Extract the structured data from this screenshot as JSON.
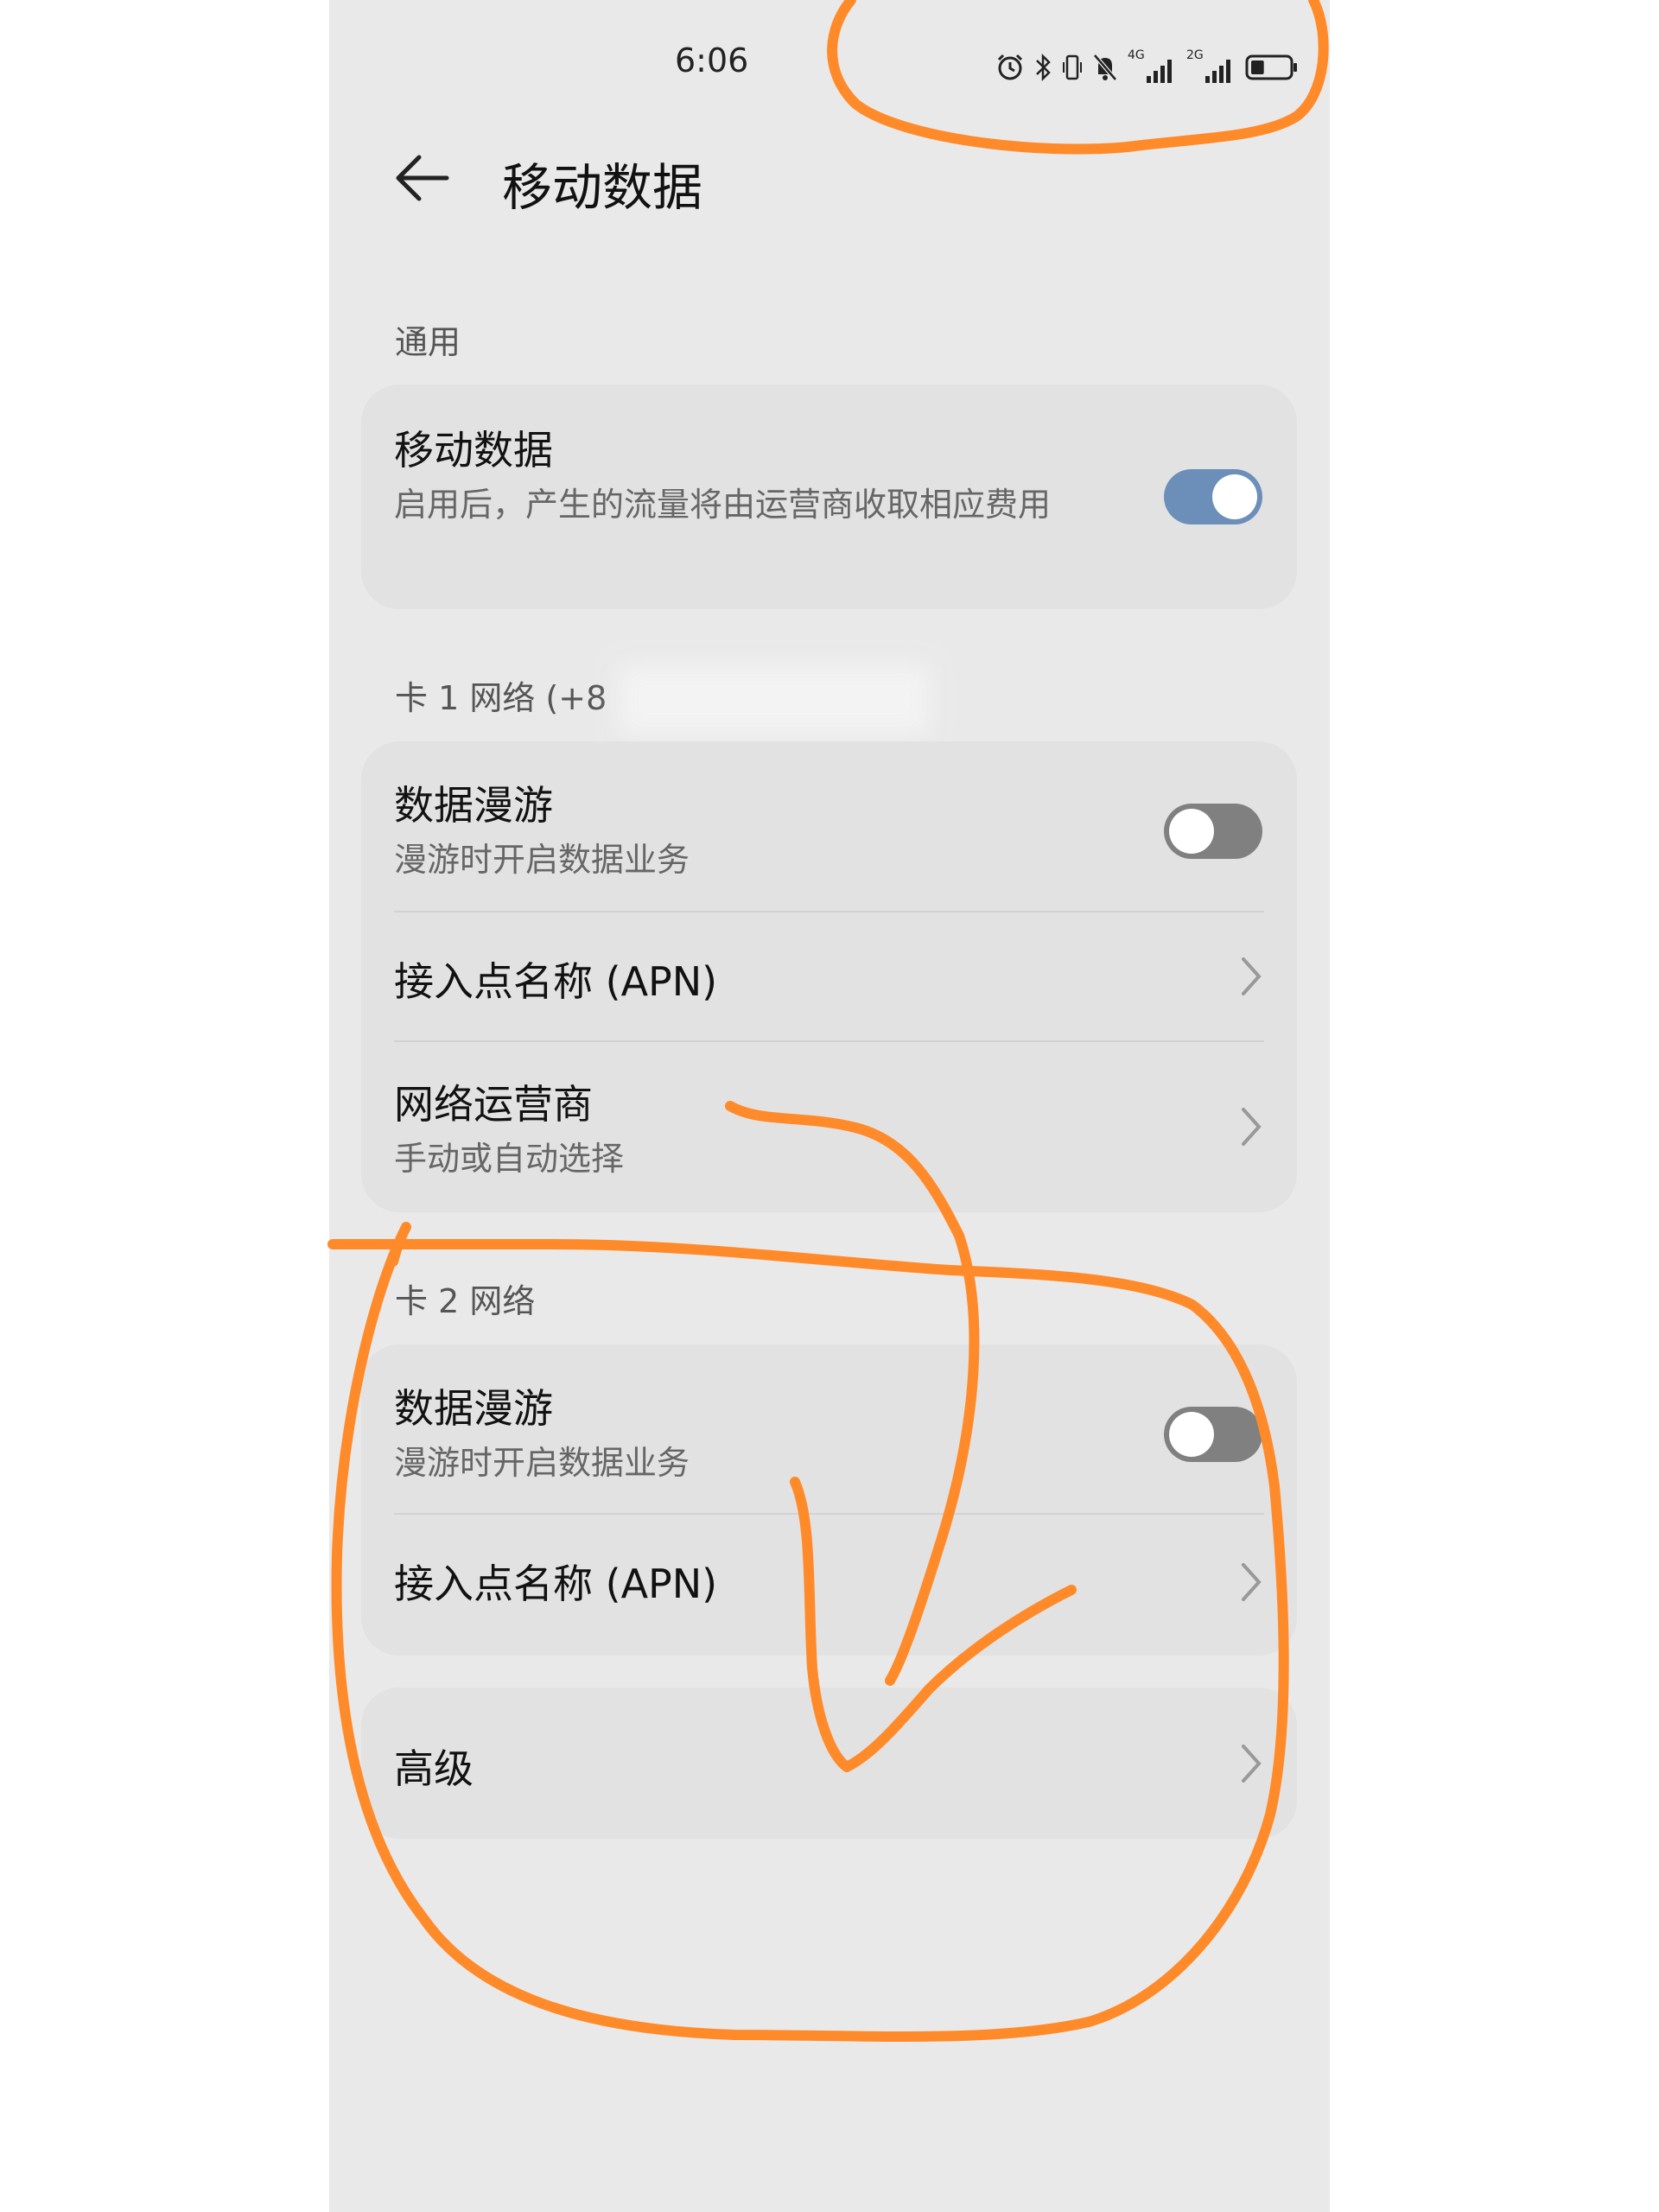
{
  "status_bar": {
    "time": "6:06",
    "sim1_network": "4G",
    "sim2_network": "2G",
    "battery_level": 0.35
  },
  "header": {
    "title": "移动数据"
  },
  "general": {
    "section_label": "通用",
    "mobile_data": {
      "title": "移动数据",
      "subtitle": "启用后，产生的流量将由运营商收取相应费用",
      "enabled": true
    }
  },
  "sim1": {
    "section_label": "卡 1 网络 (+8",
    "roaming": {
      "title": "数据漫游",
      "subtitle": "漫游时开启数据业务",
      "enabled": false
    },
    "apn_label": "接入点名称 (APN)",
    "carrier": {
      "title": "网络运营商",
      "subtitle": "手动或自动选择"
    }
  },
  "sim2": {
    "section_label": "卡 2 网络",
    "roaming": {
      "title": "数据漫游",
      "subtitle": "漫游时开启数据业务",
      "enabled": false
    },
    "apn_label": "接入点名称 (APN)"
  },
  "advanced": {
    "label": "高级"
  },
  "colors": {
    "toggle_on": "#6b8fb8",
    "toggle_off": "#808080",
    "annotation": "#ff8a2a",
    "background": "#e9e9e9",
    "card": "#e2e2e2"
  },
  "icons": [
    "alarm-icon",
    "bluetooth-icon",
    "vibrate-icon",
    "mute-icon",
    "signal-icon",
    "battery-icon",
    "back-arrow-icon",
    "chevron-right-icon"
  ]
}
